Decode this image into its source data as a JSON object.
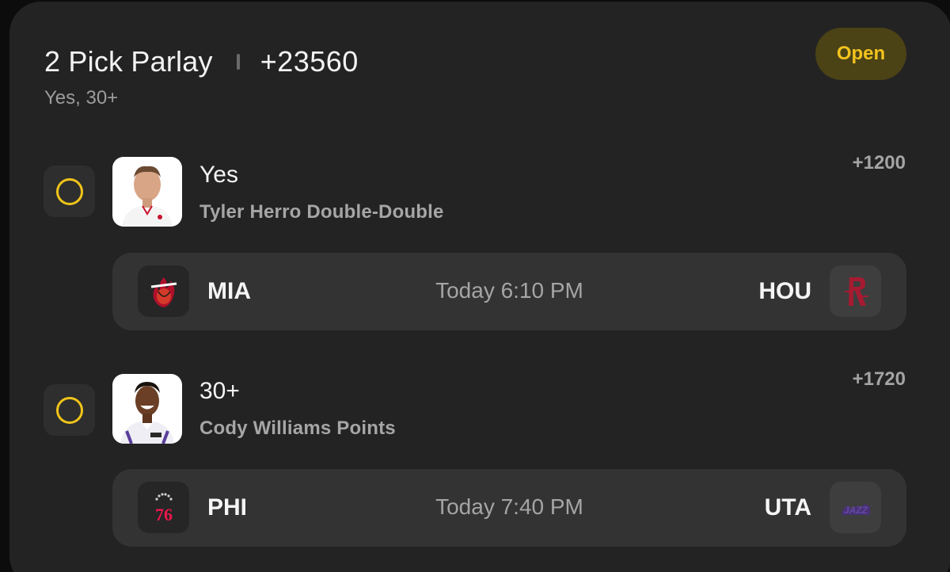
{
  "parlay": {
    "title": "2 Pick Parlay",
    "odds": "+23560",
    "summary": "Yes, 30+",
    "status": "Open"
  },
  "legs": [
    {
      "pick": "Yes",
      "market": "Tyler Herro Double-Double",
      "odds": "+1200",
      "game": {
        "away_team": "MIA",
        "home_team": "HOU",
        "time": "Today 6:10 PM",
        "away_logo_icon": "heat-logo-icon",
        "home_logo_icon": "rockets-logo-icon"
      }
    },
    {
      "pick": "30+",
      "market": "Cody Williams Points",
      "odds": "+1720",
      "game": {
        "away_team": "PHI",
        "home_team": "UTA",
        "time": "Today 7:40 PM",
        "away_logo_icon": "76ers-logo-icon",
        "home_logo_icon": "jazz-logo-icon"
      }
    }
  ],
  "colors": {
    "accent": "#f0c419",
    "badge_bg": "#4b4216",
    "card_bg": "#232323",
    "game_bg": "#333333"
  }
}
